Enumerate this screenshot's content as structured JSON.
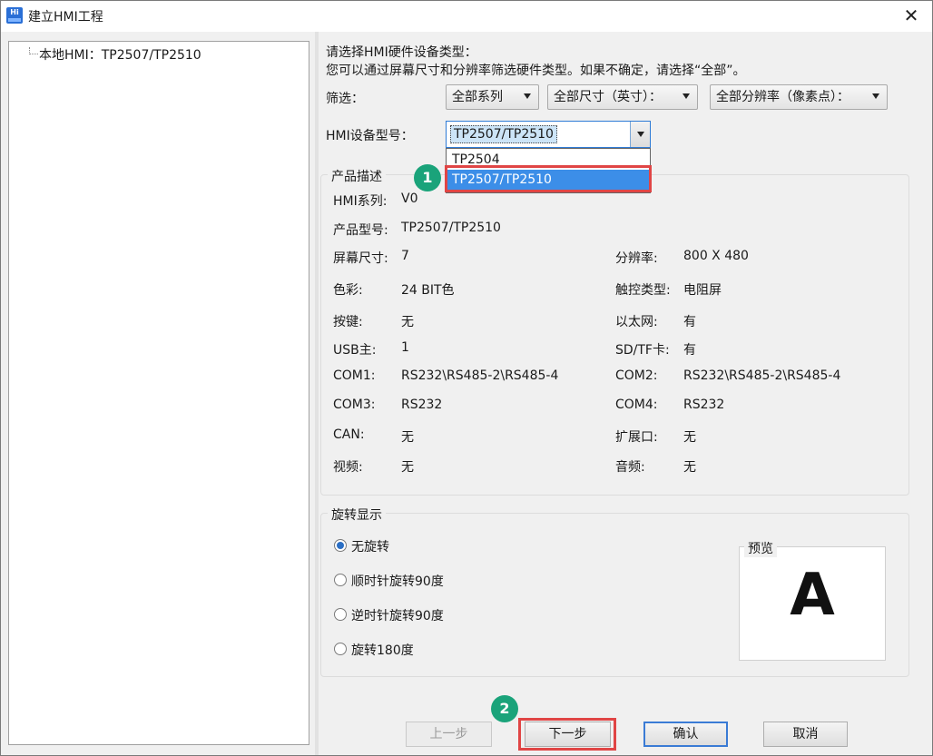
{
  "window": {
    "title": "建立HMI工程",
    "icon_text": "Hi",
    "close_glyph": "✕"
  },
  "tree": {
    "root_label": "本地HMI：TP2507/TP2510"
  },
  "instructions": {
    "line1": "请选择HMI硬件设备类型：",
    "line2": "您可以通过屏幕尺寸和分辨率筛选硬件类型。如果不确定，请选择“全部”。"
  },
  "filter": {
    "label": "筛选：",
    "series": "全部系列",
    "size": "全部尺寸（英寸）：",
    "resolution": "全部分辨率（像素点）："
  },
  "model": {
    "label": "HMI设备型号：",
    "selected": "TP2507/TP2510",
    "options": [
      "TP2504",
      "TP2507/TP2510"
    ],
    "selected_index": 1
  },
  "steps": [
    "1",
    "2"
  ],
  "product": {
    "title": "产品描述",
    "left": [
      {
        "key": "HMI系列:",
        "value": "V0"
      },
      {
        "key": "产品型号:",
        "value": "TP2507/TP2510"
      },
      {
        "key": "屏幕尺寸:",
        "value": "7"
      },
      {
        "key": "色彩:",
        "value": "24 BIT色"
      },
      {
        "key": "按键:",
        "value": "无"
      },
      {
        "key": "USB主:",
        "value": "1"
      },
      {
        "key": "COM1:",
        "value": "RS232\\RS485-2\\RS485-4"
      },
      {
        "key": "COM3:",
        "value": "RS232"
      },
      {
        "key": "CAN:",
        "value": "无"
      },
      {
        "key": "视频:",
        "value": "无"
      }
    ],
    "right": [
      {
        "key": "分辨率:",
        "value": "800 X 480"
      },
      {
        "key": "触控类型:",
        "value": "电阻屏"
      },
      {
        "key": "以太网:",
        "value": "有"
      },
      {
        "key": "SD/TF卡:",
        "value": "有"
      },
      {
        "key": "COM2:",
        "value": "RS232\\RS485-2\\RS485-4"
      },
      {
        "key": "COM4:",
        "value": "RS232"
      },
      {
        "key": "扩展口:",
        "value": "无"
      },
      {
        "key": "音频:",
        "value": "无"
      }
    ]
  },
  "rotation": {
    "title": "旋转显示",
    "options": [
      "无旋转",
      "顺时针旋转90度",
      "逆时针旋转90度",
      "旋转180度"
    ],
    "selected_index": 0,
    "preview_label": "预览",
    "preview_letter": "A"
  },
  "buttons": {
    "prev": "上一步",
    "next": "下一步",
    "ok": "确认",
    "cancel": "取消"
  },
  "colors": {
    "selection": "#3c8ee8",
    "highlight": "#e04545",
    "badge": "#1aa37a",
    "accent": "#3a7bd5"
  }
}
